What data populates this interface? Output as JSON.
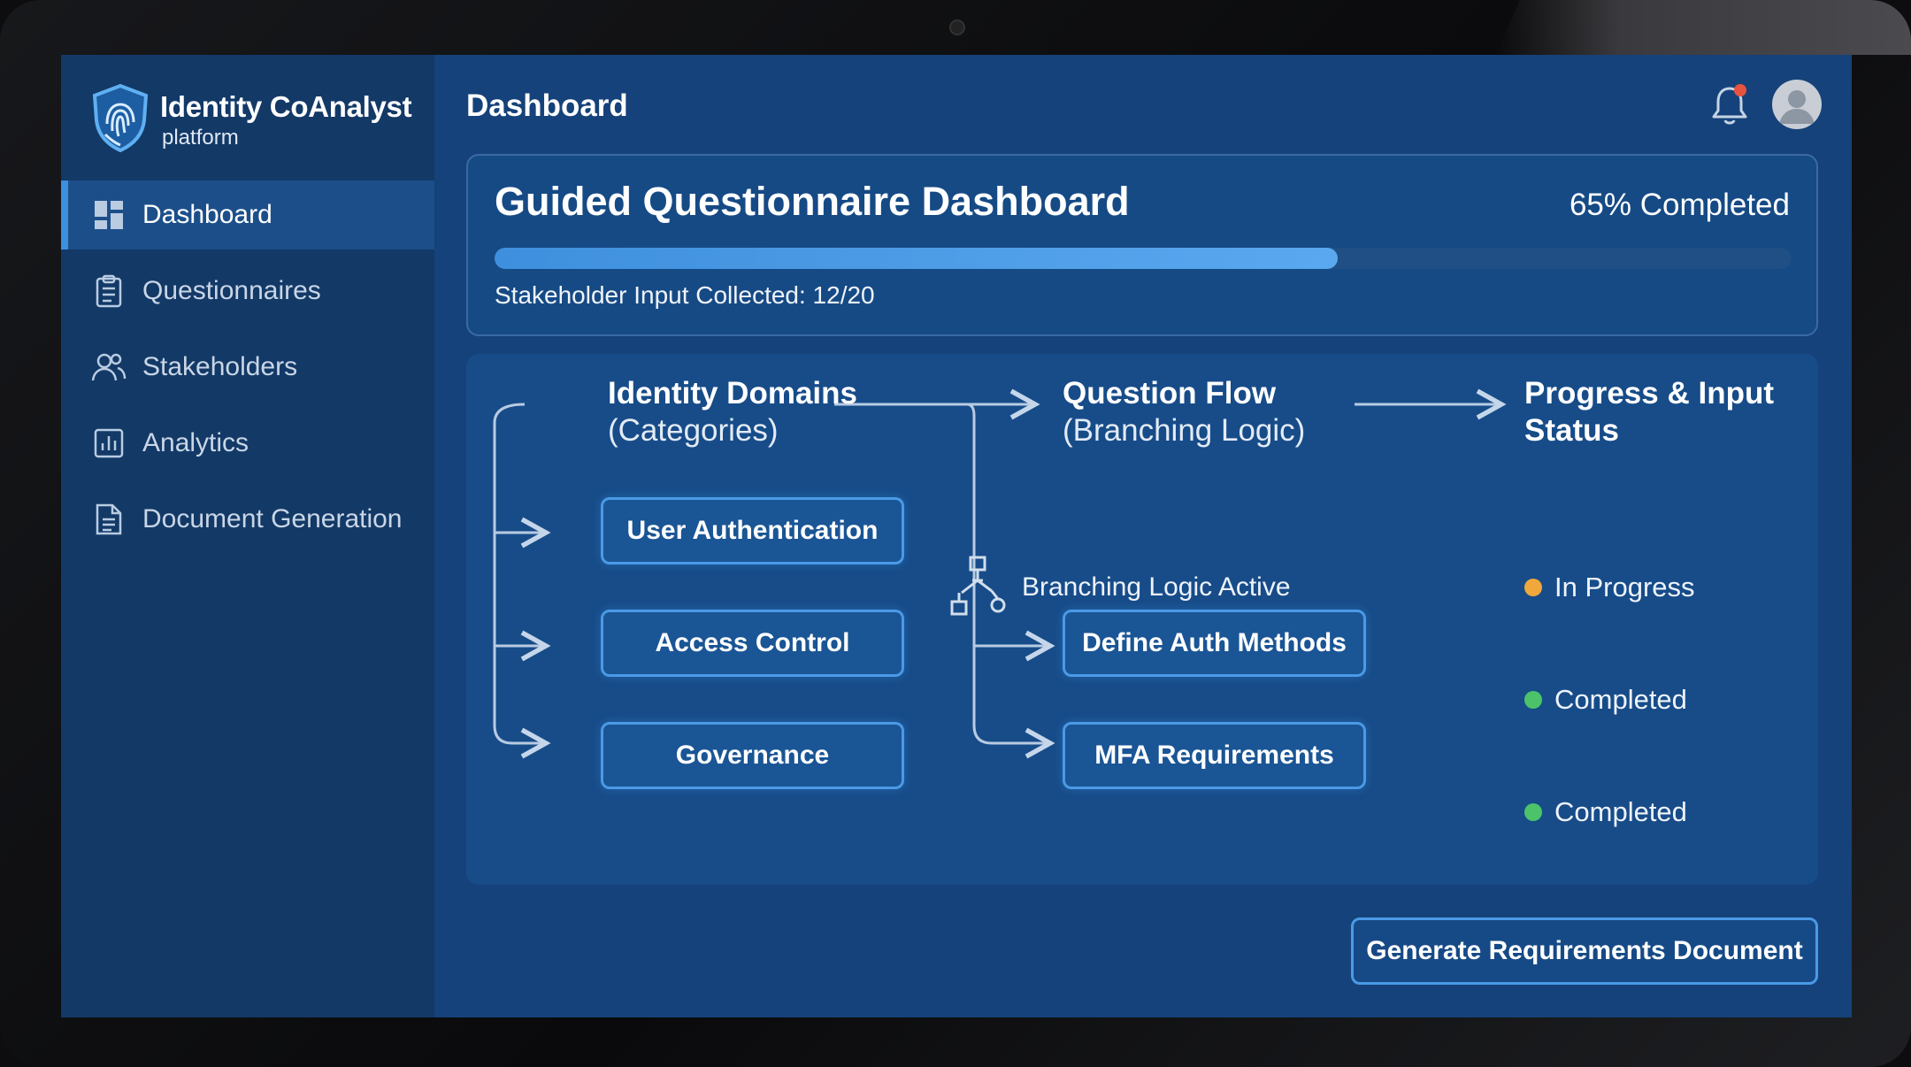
{
  "brand": {
    "name": "Identity CoAnalyst",
    "sub": "platform"
  },
  "sidebar": {
    "items": [
      {
        "label": "Dashboard",
        "icon": "dashboard-icon",
        "active": true
      },
      {
        "label": "Questionnaires",
        "icon": "clipboard-icon",
        "active": false
      },
      {
        "label": "Stakeholders",
        "icon": "users-icon",
        "active": false
      },
      {
        "label": "Analytics",
        "icon": "chart-icon",
        "active": false
      },
      {
        "label": "Document Generation",
        "icon": "document-icon",
        "active": false
      }
    ]
  },
  "header": {
    "title": "Dashboard"
  },
  "progress": {
    "title": "Guided Questionnaire Dashboard",
    "percent_label": "65% Completed",
    "percent": 65,
    "input_label": "Stakeholder Input Collected: 12/20"
  },
  "flow": {
    "domains": {
      "heading": "Identity Domains",
      "sub": "(Categories)",
      "items": [
        "User Authentication",
        "Access Control",
        "Governance"
      ]
    },
    "questions": {
      "heading": "Question Flow",
      "sub": "(Branching Logic)",
      "branch_label": "Branching Logic Active",
      "items": [
        "Define Auth Methods",
        "MFA Requirements"
      ]
    },
    "status": {
      "heading_line1": "Progress & Input",
      "heading_line2": "Status",
      "items": [
        {
          "label": "In Progress",
          "color": "#f0a83c"
        },
        {
          "label": "Completed",
          "color": "#4cc36a"
        },
        {
          "label": "Completed",
          "color": "#4cc36a"
        }
      ]
    }
  },
  "actions": {
    "generate_label": "Generate Requirements Document"
  },
  "colors": {
    "accent": "#3d8fe0",
    "panel": "#174c89",
    "sidebar": "#133967",
    "notification": "#e8533f"
  }
}
